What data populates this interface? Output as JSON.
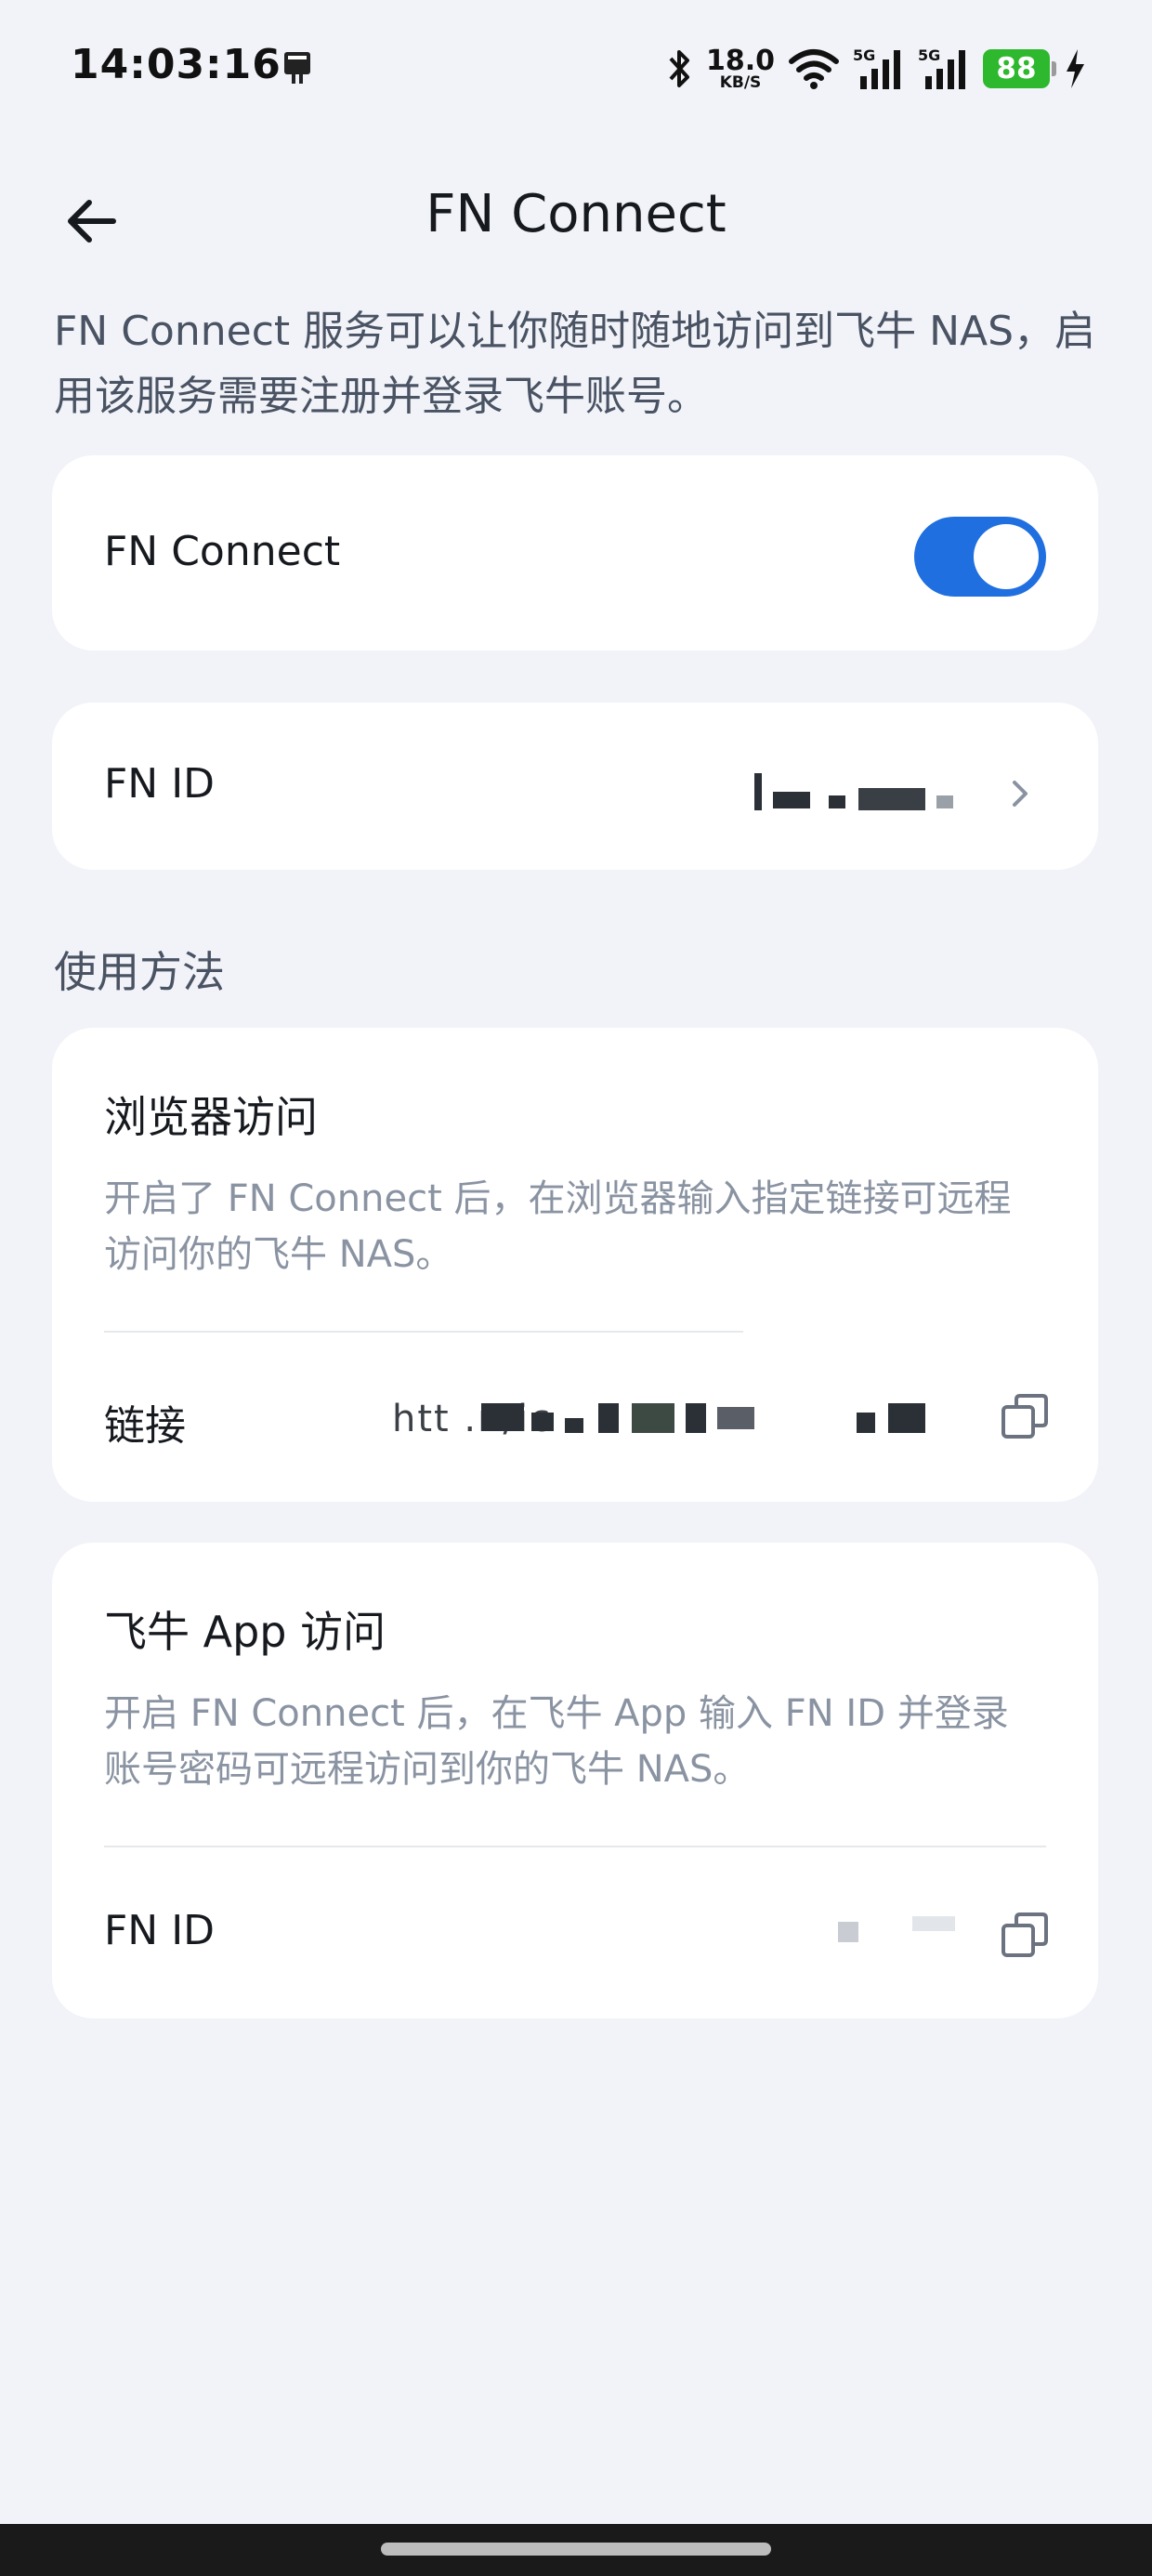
{
  "status_bar": {
    "time": "14:03:16",
    "net_speed_value": "18.0",
    "net_speed_unit": "KB/S",
    "signal_1_label": "5G",
    "signal_2_label": "5G",
    "battery_level": "88",
    "icons": [
      "app-notification-icon",
      "bluetooth-icon",
      "wifi-icon",
      "cellular-signal-icon",
      "battery-icon",
      "charging-bolt-icon"
    ],
    "battery_color": "#2EB82E"
  },
  "header": {
    "title": "FN Connect",
    "back_icon": "back-arrow-icon"
  },
  "intro": {
    "text": "FN Connect 服务可以让你随时随地访问到飞牛 NAS，启用该服务需要注册并登录飞牛账号。"
  },
  "connect_toggle": {
    "label": "FN Connect",
    "enabled": true,
    "accent_color": "#1F6FE0"
  },
  "fn_id_row": {
    "label": "FN ID",
    "icon": "chevron-right-icon"
  },
  "usage": {
    "section_title": "使用方法",
    "browser_access": {
      "title": "浏览器访问",
      "description": "开启了 FN Connect 后，在浏览器输入指定链接可远程访问你的飞牛 NAS。",
      "link_label": "链接",
      "link_visible_fragment": "htt          .n/ic",
      "copy_icon": "copy-icon"
    },
    "app_access": {
      "title": "飞牛 App 访问",
      "description": "开启 FN Connect 后，在飞牛 App 输入 FN ID 并登录账号密码可远程访问到你的飞牛 NAS。",
      "id_label": "FN ID",
      "copy_icon": "copy-icon"
    }
  }
}
